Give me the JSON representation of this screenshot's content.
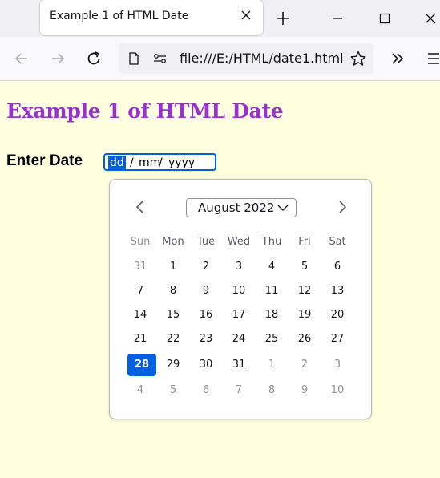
{
  "browser": {
    "tab_title": "Example 1 of HTML Date",
    "url": "file:///E:/HTML/date1.html"
  },
  "page": {
    "heading": "Example 1 of HTML Date",
    "date_label": "Enter Date",
    "date_input": {
      "day": "dd",
      "sep1": "/",
      "month": "mm",
      "sep2": "/",
      "year": "yyyy"
    }
  },
  "calendar": {
    "month_year": "August 2022",
    "weekdays": [
      "Sun",
      "Mon",
      "Tue",
      "Wed",
      "Thu",
      "Fri",
      "Sat"
    ],
    "weeks": [
      [
        "31",
        "1",
        "2",
        "3",
        "4",
        "5",
        "6"
      ],
      [
        "7",
        "8",
        "9",
        "10",
        "11",
        "12",
        "13"
      ],
      [
        "14",
        "15",
        "16",
        "17",
        "18",
        "19",
        "20"
      ],
      [
        "21",
        "22",
        "23",
        "24",
        "25",
        "26",
        "27"
      ],
      [
        "28",
        "29",
        "30",
        "31",
        "1",
        "2",
        "3"
      ],
      [
        "4",
        "5",
        "6",
        "7",
        "8",
        "9",
        "10"
      ]
    ],
    "selected_day": "28"
  },
  "colors": {
    "page_background": "#ffffe0",
    "heading": "#9932cc",
    "accent": "#0060df"
  },
  "icons": {
    "tab_close": "close-icon",
    "new_tab": "plus-icon",
    "minimize": "minimize-icon",
    "maximize": "maximize-icon",
    "close_window": "close-window-icon",
    "back": "back-arrow-icon",
    "forward": "forward-arrow-icon",
    "reload": "reload-icon",
    "page": "page-icon",
    "permissions": "permissions-icon",
    "bookmark": "star-icon",
    "overflow": "double-chevron-icon",
    "menu": "hamburger-icon",
    "prev_month": "chevron-left-icon",
    "next_month": "chevron-right-icon",
    "month_dropdown": "chevron-down-icon"
  }
}
